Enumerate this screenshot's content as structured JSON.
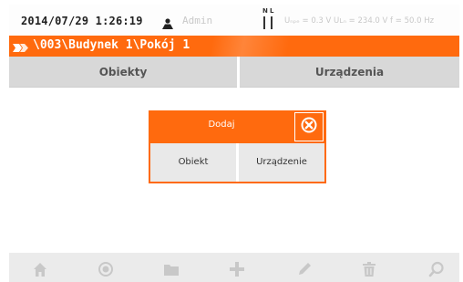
{
  "status": {
    "datetime": "2014/07/29 1:26:19",
    "user": "Admin",
    "user_icon": "person-icon",
    "phase_n": "N",
    "phase_l": "L",
    "measurements": "Uₙₚₑ = 0.3 V Uʟₙ = 234.0 V f = 50.0 Hz"
  },
  "path": {
    "icon": "location-arrows-icon",
    "text": "\\003\\Budynek 1\\Pokój 1"
  },
  "tabs": [
    {
      "label": "Obiekty"
    },
    {
      "label": "Urządzenia"
    }
  ],
  "dialog": {
    "title": "Dodaj",
    "close_icon": "close-circle-icon",
    "buttons": [
      {
        "label": "Obiekt"
      },
      {
        "label": "Urządzenie"
      }
    ]
  },
  "toolbar": {
    "items": [
      {
        "icon": "home-icon"
      },
      {
        "icon": "target-icon"
      },
      {
        "icon": "folder-icon"
      },
      {
        "icon": "plus-icon"
      },
      {
        "icon": "pencil-icon"
      },
      {
        "icon": "trash-icon"
      },
      {
        "icon": "search-icon"
      }
    ]
  },
  "colors": {
    "accent": "#ff6a0e",
    "tab_bg": "#d8d8d8",
    "toolbar_bg": "#ebebeb",
    "toolbar_icon": "#c8c8c8"
  }
}
